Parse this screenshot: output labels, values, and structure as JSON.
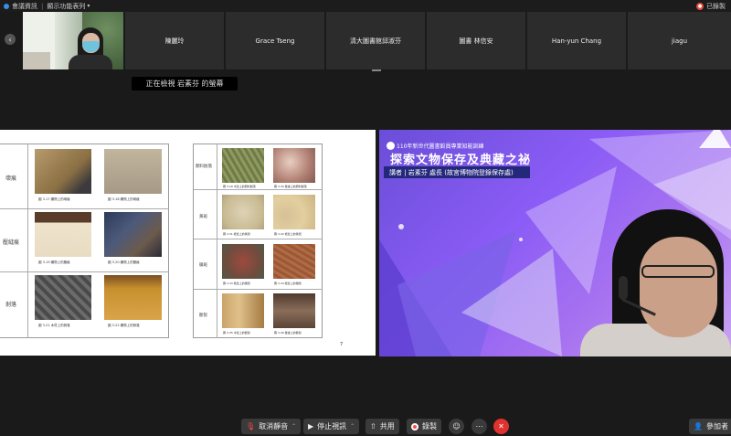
{
  "topbar": {
    "meeting_info": "會議資訊",
    "view_options": "顯示功能表列",
    "recording": "已錄製"
  },
  "strip": {
    "self_name": "",
    "participants": [
      {
        "name": "陳麗玲"
      },
      {
        "name": "Grace Tseng"
      },
      {
        "name": "清大圖書館邱淑芬"
      },
      {
        "name": "圖書 林信安"
      },
      {
        "name": "Han-yun Chang"
      },
      {
        "name": "jiagu"
      }
    ],
    "viewing_label": "正在檢視 岩素芬 的螢幕"
  },
  "doc": {
    "left_rows": [
      {
        "label": "壞痕",
        "caps": [
          "圖 3-17 纖物上的壞痕",
          "圖 3-18 纖物上的壞痕"
        ]
      },
      {
        "label": "壓縫痕",
        "caps": [
          "圖 3-19 纖物上的壓痕",
          "圖 3-20 纖物上的壓痕"
        ]
      },
      {
        "label": "剝落",
        "caps": [
          "圖 3-21 木質上的剝落",
          "圖 3-22 纖物上的剝落"
        ]
      }
    ],
    "right_rows": [
      {
        "label": "顏料脫落",
        "caps": [
          "圖 3-29 木質上的顏料脫落",
          "圖 3-30 壁畫上的顏料脫落"
        ]
      },
      {
        "label": "黃斑",
        "caps": [
          "圖 3-31 紙質上的黃斑",
          "圖 3-32 紙質上的黃斑"
        ]
      },
      {
        "label": "黴斑",
        "caps": [
          "圖 3-33 紙質上的黴斑",
          "圖 3-34 紙質上的黴斑"
        ]
      },
      {
        "label": "斷裂",
        "caps": [
          "圖 3-35 木質上的斷裂",
          "圖 3-36 壁畫上的斷裂"
        ]
      }
    ],
    "page_number": "7"
  },
  "slide": {
    "banner": "110年新世代圖書館員專業知能訓練",
    "title": "探索文物保存及典藏之祕",
    "speaker": "講者 | 岩素芬 處長 (故宮博物院登錄保存處)"
  },
  "bottombar": {
    "mute": "取消靜音",
    "stop_video": "停止視訊",
    "share": "共用",
    "record": "錄製",
    "participants": "參加者"
  },
  "colors": {
    "end_button": "#e0322f",
    "slide_purple": "#8b5cf6",
    "speaker_band": "#24287a"
  }
}
